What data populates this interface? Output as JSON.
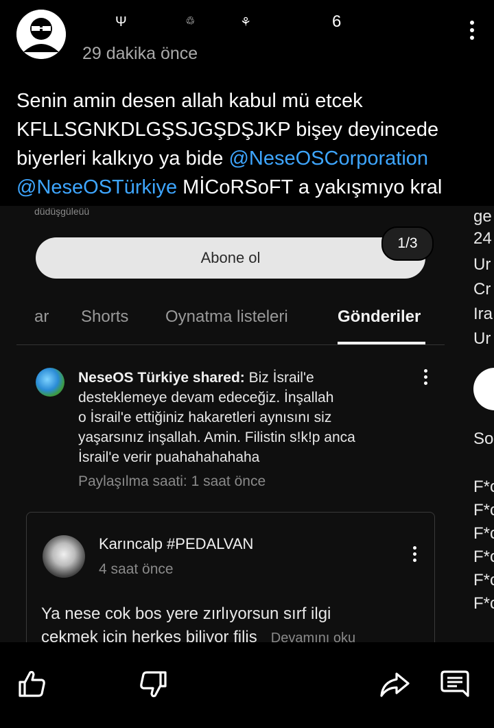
{
  "post": {
    "author_glyphs": [
      "Ψ",
      "♲",
      "⚘",
      "6"
    ],
    "time": "29 dakika önce",
    "text_line1": "Senin amin desen allah kabul mü etcek",
    "text_line2": "KFLLSGNKDLGŞSJGŞDŞJKP bişey deyincede",
    "text_line3_pre": "biyerleri kalkıyo ya bide ",
    "mention1": "@NeseOSCorporation",
    "mention2": "@NeseOSTürkiye",
    "text_line4_post": " MİCoRSoFT a yakışmıyo kral"
  },
  "embed": {
    "top_strip": "düdüşgüleüü",
    "subscribe_label": "Abone ol",
    "image_counter": "1/3",
    "tabs": [
      "ar",
      "Shorts",
      "Oynatma listeleri",
      "Gönderiler"
    ],
    "shared": {
      "author": "NeseOS Türkiye shared:",
      "text1": " Biz İsrail'e",
      "text2": "desteklemeye devam edeceğiz. İnşallah",
      "text3": "o İsrail'e ettiğiniz hakaretleri aynısını siz",
      "text4": "yaşarsınız inşallah. Amin. Filistin s!k!p anca",
      "text5": "İsrail'e verir puahahahahaha",
      "time": "Paylaşılma saati: 1 saat önce"
    },
    "comment": {
      "author": "Karıncalp #PEDALVAN",
      "time": "4 saat önce",
      "text1": "Ya nese cok bos yere zırlıyorsun sırf ilgi",
      "text2": "cekmek icin herkes biliyor filis",
      "more": "Devamını oku"
    }
  },
  "peek": {
    "lines_top": [
      "ge",
      "24",
      "Ur",
      "Cr",
      "Ira",
      "Ur"
    ],
    "so": "So",
    "lines_bottom": [
      "F*c",
      "F*c",
      "F*c",
      "F*c",
      "F*c",
      "F*c"
    ]
  },
  "actions": {
    "like": "like-icon",
    "dislike": "dislike-icon",
    "share": "share-icon",
    "comment": "comment-icon"
  }
}
